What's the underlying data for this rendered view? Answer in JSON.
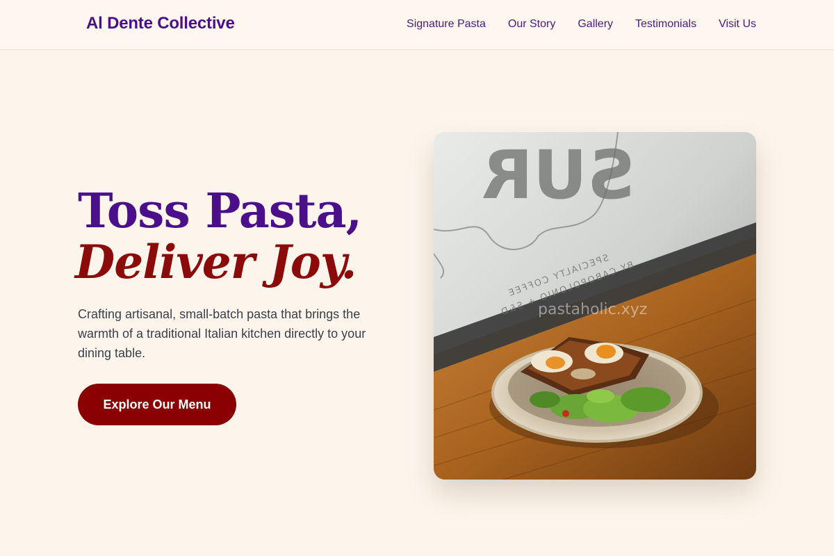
{
  "header": {
    "brand": "Al Dente Collective",
    "nav": [
      "Signature Pasta",
      "Our Story",
      "Gallery",
      "Testimonials",
      "Visit Us"
    ]
  },
  "hero": {
    "title_line1": "Toss Pasta,",
    "title_line2": "Deliver Joy.",
    "description": "Crafting artisanal, small-batch pasta that brings the warmth of a traditional Italian kitchen directly to your dining table.",
    "cta_label": "Explore Our Menu"
  },
  "image": {
    "window_sign": "SUR",
    "window_text_1": "SPECIALTY COFFEE",
    "window_text_2": "BY CABOPOLONIO + S&D",
    "watermark": "pastaholic.xyz"
  },
  "colors": {
    "brand_purple": "#4b0f8a",
    "accent_red": "#8b0000",
    "background": "#fdf5ec"
  }
}
